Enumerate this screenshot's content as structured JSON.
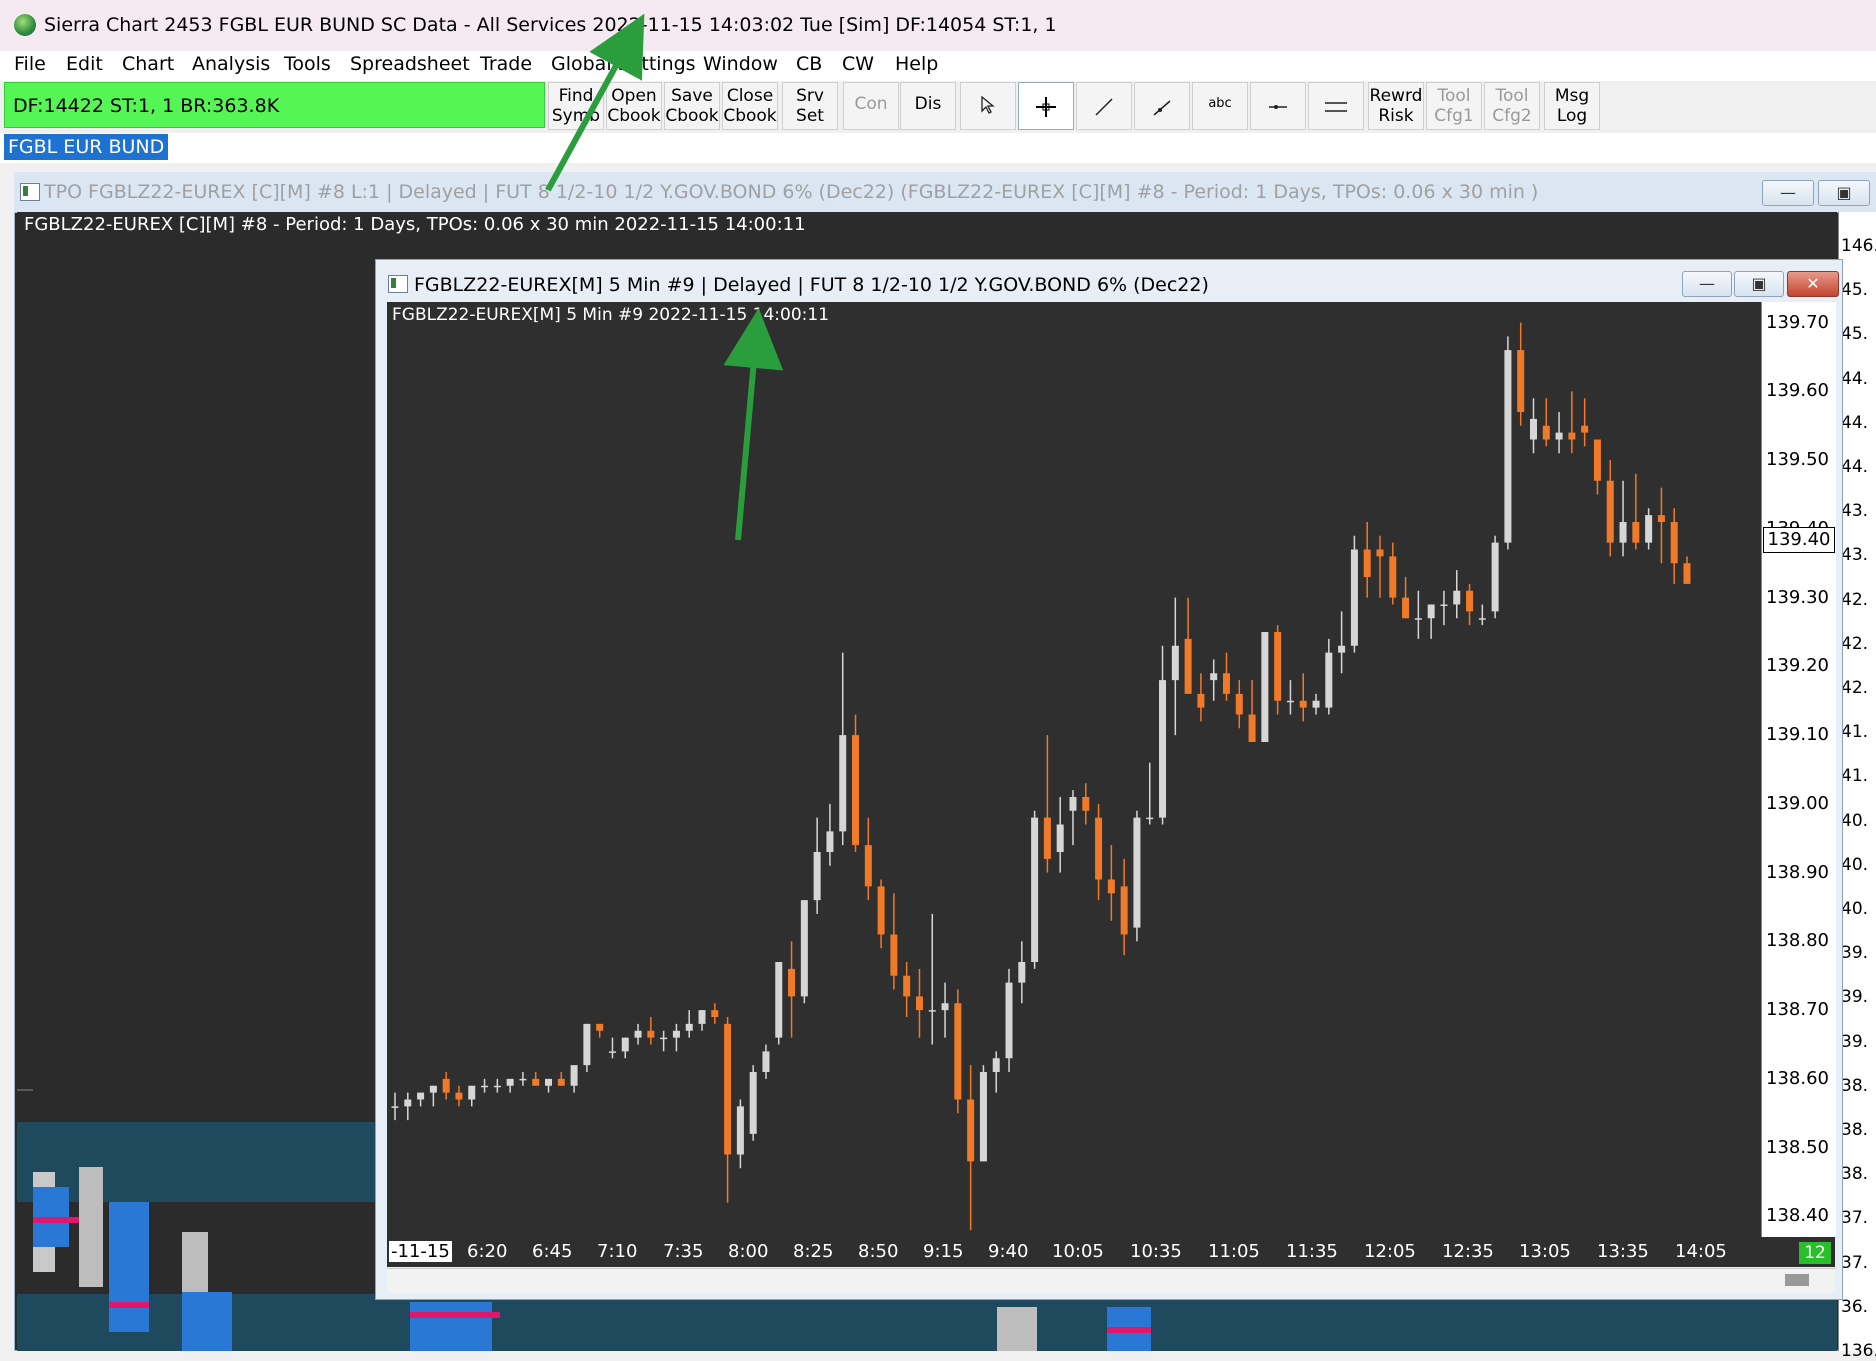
{
  "app": {
    "title": "Sierra Chart 2453 FGBL EUR BUND  SC Data - All Services 2022-11-15  14:03:02 Tue [Sim]  DF:14054  ST:1, 1"
  },
  "menu": [
    "File",
    "Edit",
    "Chart",
    "Analysis",
    "Tools",
    "Spreadsheet",
    "Trade",
    "Global Settings",
    "Window",
    "CB",
    "CW",
    "Help"
  ],
  "status": {
    "text": "DF:14422  ST:1, 1   BR:363.8K"
  },
  "toolbar": [
    {
      "l1": "Find",
      "l2": "Symb"
    },
    {
      "l1": "Open",
      "l2": "Cbook"
    },
    {
      "l1": "Save",
      "l2": "Cbook"
    },
    {
      "l1": "Close",
      "l2": "Cbook"
    },
    {
      "l1": "Srv",
      "l2": "Set"
    },
    {
      "l1": "Con"
    },
    {
      "l1": "Dis"
    },
    {
      "icon": "pointer-icon"
    },
    {
      "icon": "crosshair-icon"
    },
    {
      "icon": "line-tool-icon"
    },
    {
      "icon": "ray-tool-icon"
    },
    {
      "l1": "abc"
    },
    {
      "icon": "marker-tool-icon"
    },
    {
      "icon": "rectangle-tool-icon"
    },
    {
      "l1": "Rewrd",
      "l2": "Risk"
    },
    {
      "l1": "Tool",
      "l2": "Cfg1"
    },
    {
      "l1": "Tool",
      "l2": "Cfg2"
    },
    {
      "l1": "Msg",
      "l2": "Log"
    }
  ],
  "symbol_tab": "FGBL EUR BUND",
  "outer_window": {
    "title": "TPO FGBLZ22-EUREX [C][M]  #8 L:1 | Delayed | FUT 8 1/2-10 1/2 Y.GOV.BOND 6% (Dec22) (FGBLZ22-EUREX [C][M]  #8 - Period: 1 Days, TPOs: 0.06 x 30 min  )",
    "header": "FGBLZ22-EUREX [C][M]  #8 - Period: 1 Days, TPOs: 0.06 x 30 min   2022-11-15 14:00:11",
    "scale": [
      "146.",
      "45.",
      "45.",
      "44.",
      "44.",
      "44.",
      "43.",
      "43.",
      "42.",
      "42.",
      "42.",
      "41.",
      "41.",
      "40.",
      "40.",
      "40.",
      "39.",
      "39.",
      "39.",
      "38.",
      "38.",
      "38.",
      "37.",
      "37.",
      "36.",
      "136."
    ]
  },
  "inner_window": {
    "title": "FGBLZ22-EUREX[M]  5 Min  #9 | Delayed | FUT 8 1/2-10 1/2 Y.GOV.BOND 6% (Dec22)",
    "header": "FGBLZ22-EUREX[M]  5 Min   #9 2022-11-15 14:00:11",
    "current_price": "139.40",
    "bar_counter": "12"
  },
  "chart_data": {
    "type": "candlestick",
    "x_labels": [
      "-11-15",
      "6:20",
      "6:45",
      "7:10",
      "7:35",
      "8:00",
      "8:25",
      "8:50",
      "9:15",
      "9:40",
      "10:05",
      "10:35",
      "11:05",
      "11:35",
      "12:05",
      "12:35",
      "13:05",
      "13:35",
      "14:05"
    ],
    "y_labels": [
      "139.70",
      "139.60",
      "139.50",
      "139.40",
      "139.30",
      "139.20",
      "139.10",
      "139.00",
      "138.90",
      "138.80",
      "138.70",
      "138.60",
      "138.50",
      "138.40"
    ],
    "ylim": [
      138.37,
      139.73
    ],
    "up_color": "#d6d6d6",
    "down_color": "#f07a28",
    "candles": [
      {
        "o": 138.56,
        "h": 138.58,
        "l": 138.54,
        "c": 138.56
      },
      {
        "o": 138.56,
        "h": 138.58,
        "l": 138.54,
        "c": 138.57
      },
      {
        "o": 138.57,
        "h": 138.58,
        "l": 138.56,
        "c": 138.58
      },
      {
        "o": 138.58,
        "h": 138.59,
        "l": 138.56,
        "c": 138.59
      },
      {
        "o": 138.6,
        "h": 138.61,
        "l": 138.57,
        "c": 138.58
      },
      {
        "o": 138.58,
        "h": 138.59,
        "l": 138.56,
        "c": 138.57
      },
      {
        "o": 138.57,
        "h": 138.59,
        "l": 138.56,
        "c": 138.59
      },
      {
        "o": 138.59,
        "h": 138.6,
        "l": 138.58,
        "c": 138.59
      },
      {
        "o": 138.59,
        "h": 138.6,
        "l": 138.58,
        "c": 138.59
      },
      {
        "o": 138.59,
        "h": 138.6,
        "l": 138.58,
        "c": 138.6
      },
      {
        "o": 138.6,
        "h": 138.61,
        "l": 138.59,
        "c": 138.6
      },
      {
        "o": 138.6,
        "h": 138.61,
        "l": 138.59,
        "c": 138.59
      },
      {
        "o": 138.59,
        "h": 138.6,
        "l": 138.58,
        "c": 138.6
      },
      {
        "o": 138.6,
        "h": 138.61,
        "l": 138.59,
        "c": 138.59
      },
      {
        "o": 138.59,
        "h": 138.62,
        "l": 138.58,
        "c": 138.62
      },
      {
        "o": 138.62,
        "h": 138.68,
        "l": 138.61,
        "c": 138.68
      },
      {
        "o": 138.68,
        "h": 138.68,
        "l": 138.66,
        "c": 138.67
      },
      {
        "o": 138.64,
        "h": 138.66,
        "l": 138.63,
        "c": 138.64
      },
      {
        "o": 138.64,
        "h": 138.66,
        "l": 138.63,
        "c": 138.66
      },
      {
        "o": 138.66,
        "h": 138.68,
        "l": 138.65,
        "c": 138.67
      },
      {
        "o": 138.67,
        "h": 138.69,
        "l": 138.65,
        "c": 138.66
      },
      {
        "o": 138.66,
        "h": 138.67,
        "l": 138.64,
        "c": 138.66
      },
      {
        "o": 138.66,
        "h": 138.68,
        "l": 138.64,
        "c": 138.67
      },
      {
        "o": 138.67,
        "h": 138.7,
        "l": 138.66,
        "c": 138.68
      },
      {
        "o": 138.68,
        "h": 138.7,
        "l": 138.67,
        "c": 138.7
      },
      {
        "o": 138.7,
        "h": 138.71,
        "l": 138.68,
        "c": 138.69
      },
      {
        "o": 138.68,
        "h": 138.69,
        "l": 138.42,
        "c": 138.49
      },
      {
        "o": 138.49,
        "h": 138.57,
        "l": 138.47,
        "c": 138.56
      },
      {
        "o": 138.52,
        "h": 138.62,
        "l": 138.51,
        "c": 138.61
      },
      {
        "o": 138.61,
        "h": 138.65,
        "l": 138.6,
        "c": 138.64
      },
      {
        "o": 138.66,
        "h": 138.77,
        "l": 138.65,
        "c": 138.77
      },
      {
        "o": 138.76,
        "h": 138.8,
        "l": 138.66,
        "c": 138.72
      },
      {
        "o": 138.72,
        "h": 138.86,
        "l": 138.71,
        "c": 138.86
      },
      {
        "o": 138.86,
        "h": 138.98,
        "l": 138.84,
        "c": 138.93
      },
      {
        "o": 138.93,
        "h": 139.0,
        "l": 138.91,
        "c": 138.96
      },
      {
        "o": 138.96,
        "h": 139.22,
        "l": 138.94,
        "c": 139.1
      },
      {
        "o": 139.1,
        "h": 139.13,
        "l": 138.93,
        "c": 138.94
      },
      {
        "o": 138.94,
        "h": 138.98,
        "l": 138.86,
        "c": 138.88
      },
      {
        "o": 138.88,
        "h": 138.89,
        "l": 138.79,
        "c": 138.81
      },
      {
        "o": 138.81,
        "h": 138.87,
        "l": 138.73,
        "c": 138.75
      },
      {
        "o": 138.75,
        "h": 138.77,
        "l": 138.69,
        "c": 138.72
      },
      {
        "o": 138.72,
        "h": 138.76,
        "l": 138.66,
        "c": 138.7
      },
      {
        "o": 138.7,
        "h": 138.84,
        "l": 138.65,
        "c": 138.7
      },
      {
        "o": 138.7,
        "h": 138.74,
        "l": 138.66,
        "c": 138.71
      },
      {
        "o": 138.71,
        "h": 138.73,
        "l": 138.55,
        "c": 138.57
      },
      {
        "o": 138.57,
        "h": 138.62,
        "l": 138.38,
        "c": 138.48
      },
      {
        "o": 138.48,
        "h": 138.62,
        "l": 138.48,
        "c": 138.61
      },
      {
        "o": 138.61,
        "h": 138.64,
        "l": 138.58,
        "c": 138.63
      },
      {
        "o": 138.63,
        "h": 138.76,
        "l": 138.61,
        "c": 138.74
      },
      {
        "o": 138.74,
        "h": 138.8,
        "l": 138.71,
        "c": 138.77
      },
      {
        "o": 138.77,
        "h": 138.99,
        "l": 138.76,
        "c": 138.98
      },
      {
        "o": 138.98,
        "h": 139.1,
        "l": 138.9,
        "c": 138.92
      },
      {
        "o": 138.93,
        "h": 139.01,
        "l": 138.9,
        "c": 138.97
      },
      {
        "o": 138.99,
        "h": 139.02,
        "l": 138.94,
        "c": 139.01
      },
      {
        "o": 139.01,
        "h": 139.03,
        "l": 138.97,
        "c": 138.99
      },
      {
        "o": 138.98,
        "h": 139.0,
        "l": 138.86,
        "c": 138.89
      },
      {
        "o": 138.89,
        "h": 138.94,
        "l": 138.83,
        "c": 138.87
      },
      {
        "o": 138.88,
        "h": 138.92,
        "l": 138.78,
        "c": 138.81
      },
      {
        "o": 138.82,
        "h": 138.99,
        "l": 138.8,
        "c": 138.98
      },
      {
        "o": 138.98,
        "h": 139.06,
        "l": 138.97,
        "c": 138.98
      },
      {
        "o": 138.98,
        "h": 139.23,
        "l": 138.97,
        "c": 139.18
      },
      {
        "o": 139.18,
        "h": 139.3,
        "l": 139.1,
        "c": 139.23
      },
      {
        "o": 139.24,
        "h": 139.3,
        "l": 139.16,
        "c": 139.16
      },
      {
        "o": 139.16,
        "h": 139.19,
        "l": 139.12,
        "c": 139.14
      },
      {
        "o": 139.18,
        "h": 139.21,
        "l": 139.15,
        "c": 139.19
      },
      {
        "o": 139.19,
        "h": 139.22,
        "l": 139.15,
        "c": 139.16
      },
      {
        "o": 139.16,
        "h": 139.18,
        "l": 139.11,
        "c": 139.13
      },
      {
        "o": 139.13,
        "h": 139.18,
        "l": 139.09,
        "c": 139.09
      },
      {
        "o": 139.09,
        "h": 139.25,
        "l": 139.09,
        "c": 139.25
      },
      {
        "o": 139.25,
        "h": 139.26,
        "l": 139.13,
        "c": 139.15
      },
      {
        "o": 139.15,
        "h": 139.18,
        "l": 139.13,
        "c": 139.15
      },
      {
        "o": 139.15,
        "h": 139.19,
        "l": 139.12,
        "c": 139.14
      },
      {
        "o": 139.14,
        "h": 139.16,
        "l": 139.13,
        "c": 139.15
      },
      {
        "o": 139.14,
        "h": 139.24,
        "l": 139.13,
        "c": 139.22
      },
      {
        "o": 139.22,
        "h": 139.28,
        "l": 139.19,
        "c": 139.23
      },
      {
        "o": 139.23,
        "h": 139.39,
        "l": 139.22,
        "c": 139.37
      },
      {
        "o": 139.37,
        "h": 139.41,
        "l": 139.3,
        "c": 139.33
      },
      {
        "o": 139.37,
        "h": 139.39,
        "l": 139.3,
        "c": 139.36
      },
      {
        "o": 139.36,
        "h": 139.38,
        "l": 139.29,
        "c": 139.3
      },
      {
        "o": 139.3,
        "h": 139.33,
        "l": 139.27,
        "c": 139.27
      },
      {
        "o": 139.27,
        "h": 139.31,
        "l": 139.24,
        "c": 139.27
      },
      {
        "o": 139.27,
        "h": 139.29,
        "l": 139.24,
        "c": 139.29
      },
      {
        "o": 139.29,
        "h": 139.31,
        "l": 139.26,
        "c": 139.29
      },
      {
        "o": 139.29,
        "h": 139.34,
        "l": 139.27,
        "c": 139.31
      },
      {
        "o": 139.31,
        "h": 139.32,
        "l": 139.26,
        "c": 139.28
      },
      {
        "o": 139.27,
        "h": 139.29,
        "l": 139.26,
        "c": 139.27
      },
      {
        "o": 139.28,
        "h": 139.39,
        "l": 139.27,
        "c": 139.38
      },
      {
        "o": 139.38,
        "h": 139.68,
        "l": 139.37,
        "c": 139.66
      },
      {
        "o": 139.66,
        "h": 139.7,
        "l": 139.55,
        "c": 139.57
      },
      {
        "o": 139.53,
        "h": 139.59,
        "l": 139.51,
        "c": 139.56
      },
      {
        "o": 139.55,
        "h": 139.59,
        "l": 139.52,
        "c": 139.53
      },
      {
        "o": 139.53,
        "h": 139.57,
        "l": 139.51,
        "c": 139.54
      },
      {
        "o": 139.54,
        "h": 139.6,
        "l": 139.51,
        "c": 139.53
      },
      {
        "o": 139.55,
        "h": 139.59,
        "l": 139.52,
        "c": 139.54
      },
      {
        "o": 139.53,
        "h": 139.53,
        "l": 139.45,
        "c": 139.47
      },
      {
        "o": 139.47,
        "h": 139.5,
        "l": 139.36,
        "c": 139.38
      },
      {
        "o": 139.38,
        "h": 139.47,
        "l": 139.36,
        "c": 139.41
      },
      {
        "o": 139.41,
        "h": 139.48,
        "l": 139.37,
        "c": 139.38
      },
      {
        "o": 139.38,
        "h": 139.43,
        "l": 139.37,
        "c": 139.42
      },
      {
        "o": 139.42,
        "h": 139.46,
        "l": 139.35,
        "c": 139.41
      },
      {
        "o": 139.41,
        "h": 139.43,
        "l": 139.32,
        "c": 139.35
      },
      {
        "o": 139.35,
        "h": 139.36,
        "l": 139.32,
        "c": 139.32
      }
    ]
  }
}
